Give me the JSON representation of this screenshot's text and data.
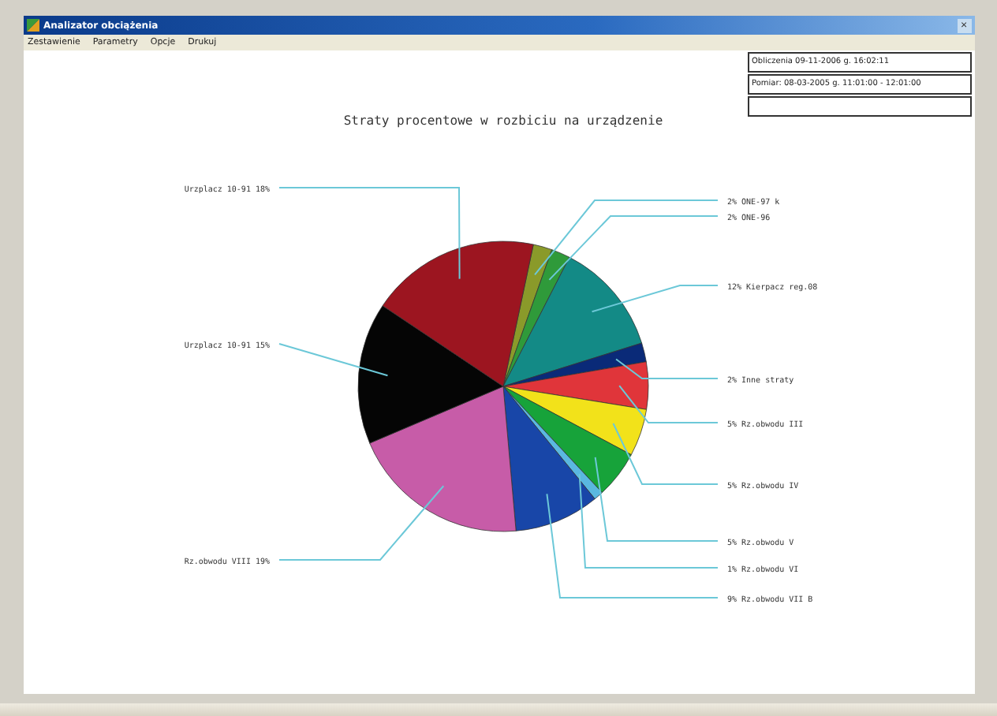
{
  "window": {
    "title": "Analizator obciążenia",
    "close": "×"
  },
  "menu": [
    {
      "label": "Zestawienie"
    },
    {
      "label": "Parametry"
    },
    {
      "label": "Opcje"
    },
    {
      "label": "Drukuj"
    }
  ],
  "info_box": [
    "Obliczenia 09-11-2006 g. 16:02:11",
    "Pomiar: 08-03-2005 g. 11:01:00 - 12:01:00"
  ],
  "chart_data": {
    "type": "pie",
    "title": "Straty procentowe w rozbiciu na urządzenie",
    "categories": [
      "2% ONE-97 k",
      "2% ONE-96",
      "12% Kierpacz reg.08",
      "2% Inne straty",
      "5% Rz.obwodu III",
      "5% Rz.obwodu IV",
      "5% Rz.obwodu V",
      "1% Rz.obwodu VI",
      "9% Rz.obwodu VII B",
      "Rz.obwodu VIII 19%",
      "Urzplacz 10-91 15%",
      "Urzplacz 10-91 18%"
    ],
    "values": [
      2,
      2,
      12,
      2,
      5,
      5,
      5,
      1,
      9,
      19,
      15,
      18
    ]
  }
}
